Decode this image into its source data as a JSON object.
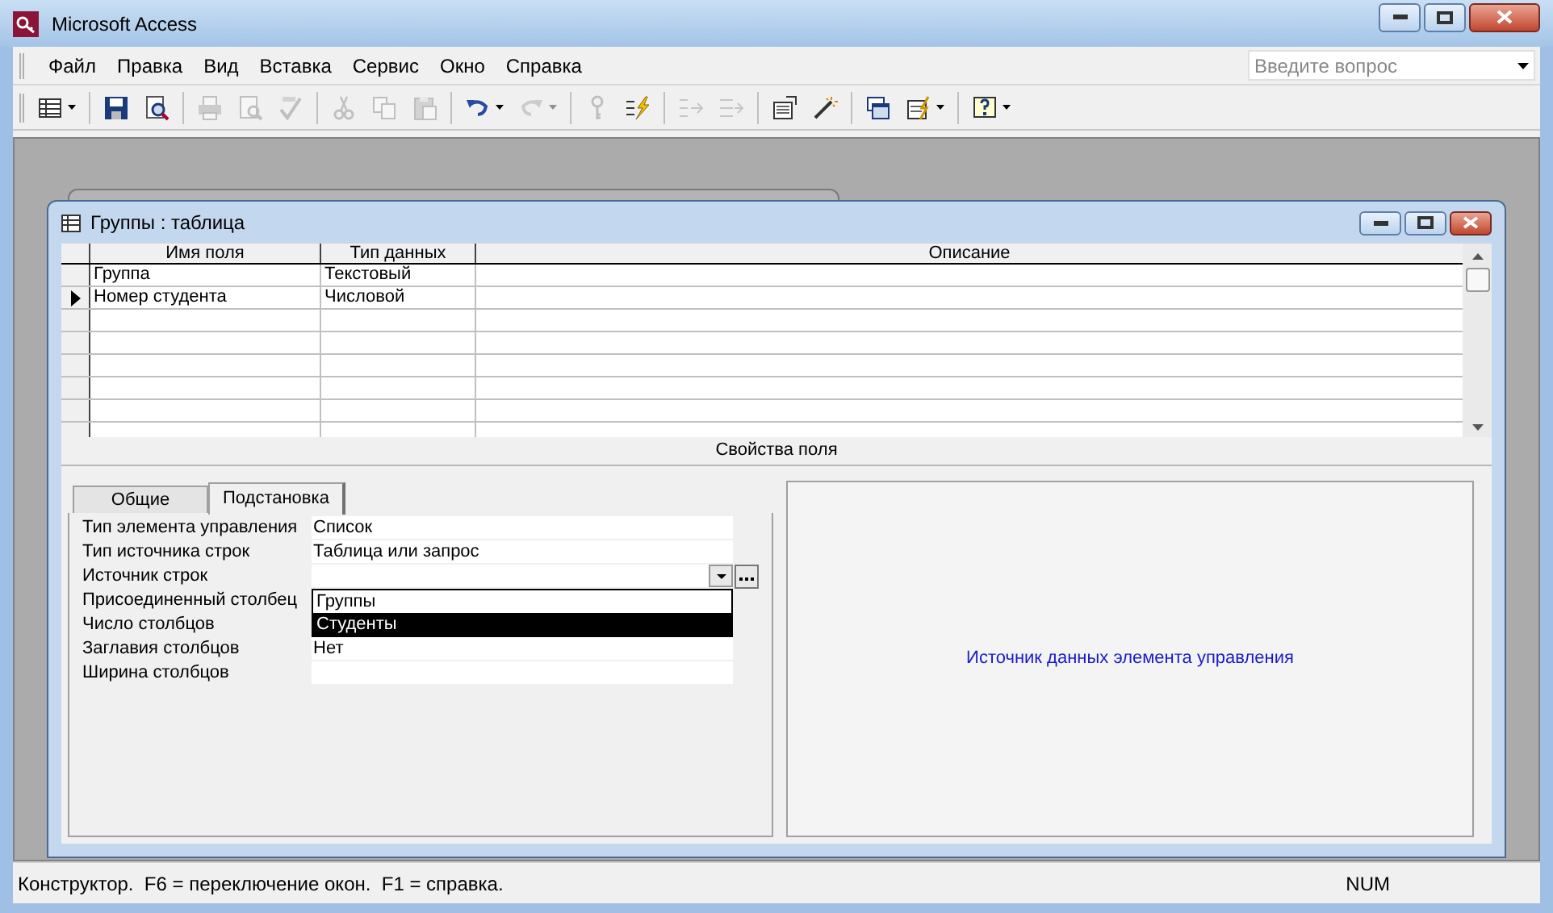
{
  "window": {
    "title": "Microsoft Access"
  },
  "menu": [
    {
      "label": "Файл"
    },
    {
      "label": "Правка"
    },
    {
      "label": "Вид"
    },
    {
      "label": "Вставка"
    },
    {
      "label": "Сервис"
    },
    {
      "label": "Окно"
    },
    {
      "label": "Справка"
    }
  ],
  "help_search": {
    "placeholder": "Введите вопрос"
  },
  "toolbar": [
    {
      "kind": "view",
      "disabled": false
    },
    {
      "kind": "separator"
    },
    {
      "kind": "save",
      "disabled": false
    },
    {
      "kind": "search",
      "disabled": false
    },
    {
      "kind": "separator"
    },
    {
      "kind": "print",
      "disabled": true
    },
    {
      "kind": "preview",
      "disabled": true
    },
    {
      "kind": "spell",
      "disabled": true
    },
    {
      "kind": "separator"
    },
    {
      "kind": "cut",
      "disabled": true
    },
    {
      "kind": "copy",
      "disabled": true
    },
    {
      "kind": "paste",
      "disabled": true
    },
    {
      "kind": "separator"
    },
    {
      "kind": "undo",
      "disabled": false
    },
    {
      "kind": "redo",
      "disabled": true
    },
    {
      "kind": "separator"
    },
    {
      "kind": "key",
      "disabled": true
    },
    {
      "kind": "lightning",
      "disabled": false
    },
    {
      "kind": "separator"
    },
    {
      "kind": "insert_rows",
      "disabled": true
    },
    {
      "kind": "delete_rows",
      "disabled": true
    },
    {
      "kind": "separator"
    },
    {
      "kind": "properties",
      "disabled": false
    },
    {
      "kind": "wand",
      "disabled": false
    },
    {
      "kind": "separator"
    },
    {
      "kind": "database",
      "disabled": false
    },
    {
      "kind": "new_object",
      "disabled": false
    },
    {
      "kind": "separator"
    },
    {
      "kind": "help",
      "disabled": false
    }
  ],
  "table_window": {
    "title": "Группы : таблица",
    "columns": [
      "Имя поля",
      "Тип данных",
      "Описание"
    ],
    "rows": [
      {
        "field": "Группа",
        "type": "Текстовый",
        "current": false
      },
      {
        "field": "Номер студента",
        "type": "Числовой",
        "current": true
      }
    ],
    "section_label": "Свойства поля",
    "tabs": [
      {
        "label": "Общие",
        "selected": false
      },
      {
        "label": "Подстановка",
        "selected": true
      }
    ],
    "properties": [
      {
        "label": "Тип элемента управления",
        "value": "Список"
      },
      {
        "label": "Тип источника строк",
        "value": "Таблица или запрос"
      },
      {
        "label": "Источник строк",
        "kind": "combo"
      },
      {
        "label": "Присоединенный столбец"
      },
      {
        "label": "Число столбцов"
      },
      {
        "label": "Заглавия столбцов",
        "value": "Нет"
      },
      {
        "label": "Ширина столбцов"
      }
    ],
    "dropdown": [
      {
        "label": "Группы",
        "selected": false
      },
      {
        "label": "Студенты",
        "selected": true
      }
    ],
    "help_text": "Источник данных элемента управления"
  },
  "status_bar": {
    "text": "Конструктор.  F6 = переключение окон.  F1 = справка.",
    "indicator": "NUM"
  }
}
